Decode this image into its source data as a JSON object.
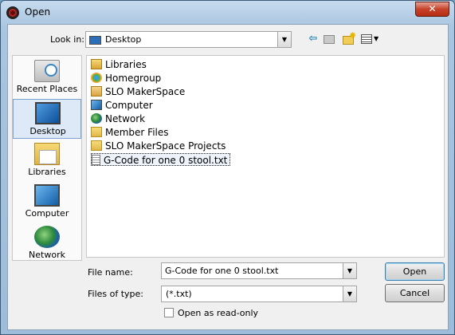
{
  "window": {
    "title": "Open",
    "close_glyph": "✕"
  },
  "toolbar": {
    "lookin_label": "Look in:",
    "lookin_value": "Desktop",
    "back_icon": "back-arrow-icon",
    "up_icon": "up-folder-icon",
    "newfolder_icon": "new-folder-icon",
    "views_icon": "view-menu-icon"
  },
  "places": [
    {
      "label": "Recent Places",
      "icon": "recent-places-icon"
    },
    {
      "label": "Desktop",
      "icon": "desktop-icon",
      "selected": true
    },
    {
      "label": "Libraries",
      "icon": "libraries-icon"
    },
    {
      "label": "Computer",
      "icon": "computer-icon"
    },
    {
      "label": "Network",
      "icon": "network-icon"
    }
  ],
  "files": [
    {
      "name": "Libraries",
      "icon": "libraries-icon"
    },
    {
      "name": "Homegroup",
      "icon": "homegroup-icon"
    },
    {
      "name": "SLO MakerSpace",
      "icon": "user-folder-icon"
    },
    {
      "name": "Computer",
      "icon": "computer-icon"
    },
    {
      "name": "Network",
      "icon": "network-icon"
    },
    {
      "name": "Member Files",
      "icon": "folder-icon"
    },
    {
      "name": "SLO MakerSpace Projects",
      "icon": "folder-icon"
    },
    {
      "name": "G-Code for one 0 stool.txt",
      "icon": "text-file-icon",
      "selected": true
    }
  ],
  "form": {
    "filename_label": "File name:",
    "filename_value": "G-Code for one 0 stool.txt",
    "filetype_label": "Files of type:",
    "filetype_value": "(*.txt)",
    "readonly_label": "Open as read-only",
    "readonly_checked": false
  },
  "buttons": {
    "open": "Open",
    "cancel": "Cancel"
  },
  "dropdown_glyph": "▼"
}
